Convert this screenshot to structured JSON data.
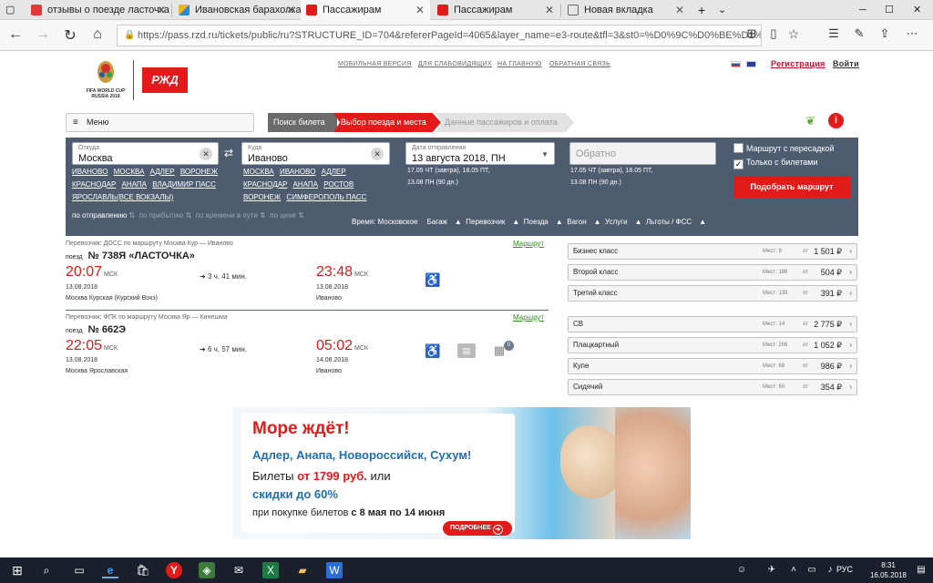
{
  "browser": {
    "tabs": [
      {
        "title": "отзывы о поезде ласточка"
      },
      {
        "title": "Ивановская барахолка | Iv"
      },
      {
        "title": "Пассажирам"
      },
      {
        "title": "Пассажирам"
      },
      {
        "title": "Новая вкладка"
      }
    ],
    "url": "https://pass.rzd.ru/tickets/public/ru?STRUCTURE_ID=704&refererPageId=4065&layer_name=e3-route&tfl=3&st0=%D0%9C%D0%BE%D1%81%D0%BA%D0%B2"
  },
  "header": {
    "logo_text": "FIFA WORLD CUP RUSSIA 2018",
    "brand": "РЖД",
    "links": [
      "МОБИЛЬНАЯ ВЕРСИЯ",
      "ДЛЯ СЛАБОВИДЯЩИХ",
      "НА ГЛАВНУЮ",
      "ОБРАТНАЯ СВЯЗЬ"
    ],
    "register": "Регистрация",
    "login": "Войти"
  },
  "menu_label": "Меню",
  "steps": [
    "Поиск билета",
    "Выбор поезда и места",
    "Данные пассажиров и оплата"
  ],
  "search": {
    "from_label": "Откуда",
    "from_value": "Москва",
    "from_suggest": [
      "ИВАНОВО",
      "МОСКВА",
      "АДЛЕР",
      "ВОРОНЕЖ",
      "КРАСНОДАР",
      "АНАПА",
      "ВЛАДИМИР ПАСС",
      "ЯРОСЛАВЛЬ(ВСЕ ВОКЗАЛЫ)"
    ],
    "to_label": "Куда",
    "to_value": "Иваново",
    "to_suggest": [
      "МОСКВА",
      "ИВАНОВО",
      "АДЛЕР",
      "КРАСНОДАР",
      "АНАПА",
      "РОСТОВ",
      "ВОРОНЕЖ",
      "СИМФЕРОПОЛЬ ПАСС"
    ],
    "date_label": "Дата отправления",
    "date_value": "13 августа 2018, ПН",
    "date_hint": [
      "17.05 ЧТ (завтра), 18.05 ПТ,",
      "13.08 ПН (90 дн.)"
    ],
    "return_placeholder": "Обратно",
    "return_hint": [
      "17.05 ЧТ (завтра), 18.05 ПТ,",
      "13.08 ПН (90 дн.)"
    ],
    "transfer_label": "Маршрут с пересадкой",
    "tickets_only_label": "Только с билетами",
    "find_button": "Подобрать маршрут",
    "sort": [
      "по отправлению",
      "по прибытию",
      "по времени в пути",
      "по цене"
    ],
    "options": [
      "Время: Московское",
      "Багаж",
      "Перевозчик",
      "Поезда",
      "Вагон",
      "Услуги",
      "Льготы / ФСС"
    ]
  },
  "trains": [
    {
      "carrier": "Перевозчик: ДОСС   по маршруту Москва Кур — Иваново",
      "route_link": "Маршрут",
      "prefix": "поезд",
      "number": "№ 738Я «ЛАСТОЧКА»",
      "dep_time": "20:07",
      "tz": "МСК",
      "duration": "3 ч. 41 мин.",
      "arr_time": "23:48",
      "dep_date": "13.08.2018",
      "dep_station": "Москва Курская (Курский Вокз)",
      "arr_date": "13.08.2018",
      "arr_station": "Иваново",
      "fares": [
        {
          "name": "Бизнес класс",
          "seats": "Мест: 8",
          "price": "1 501"
        },
        {
          "name": "Второй класс",
          "seats": "Мест: 186",
          "price": "504"
        },
        {
          "name": "Третий класс",
          "seats": "Мест: 139",
          "price": "391"
        }
      ]
    },
    {
      "carrier": "Перевозчик: ФПК   по маршруту Москва Яр — Кинешма",
      "route_link": "Маршрут",
      "prefix": "поезд",
      "number": "№ 662Э",
      "dep_time": "22:05",
      "tz": "МСК",
      "duration": "6 ч. 57 мин.",
      "arr_time": "05:02",
      "dep_date": "13.08.2018",
      "dep_station": "Москва Ярославская",
      "arr_date": "14.08.2018",
      "arr_station": "Иваново",
      "fares": [
        {
          "name": "СВ",
          "seats": "Мест: 14",
          "price": "2 775"
        },
        {
          "name": "Плацкартный",
          "seats": "Мест: 206",
          "price": "1 052"
        },
        {
          "name": "Купе",
          "seats": "Мест: 68",
          "price": "986"
        },
        {
          "name": "Сидячий",
          "seats": "Мест: 60",
          "price": "354"
        }
      ]
    }
  ],
  "fare_from": "от",
  "currency": "₽",
  "banner": {
    "headline": "Море ждёт!",
    "cities": "Адлер, Анапа, Новороссийск, Сухум!",
    "line1_a": "Билеты ",
    "line1_b": "от 1799 руб.",
    "line1_c": " или",
    "line2": "скидки до 60%",
    "line3_a": "при покупке билетов ",
    "line3_b": "с 8 мая по 14 июня",
    "more": "ПОДРОБНЕЕ"
  },
  "taskbar": {
    "lang": "РУС",
    "time": "8:31",
    "date": "16.05.2018"
  },
  "colors": {
    "accent": "#e21a1a",
    "panel": "#4d5d6f",
    "link_green": "#3a8c2a"
  }
}
